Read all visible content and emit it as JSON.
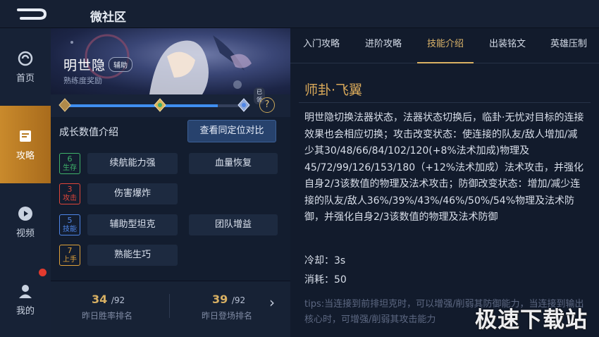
{
  "topbar": {
    "title": "微社区",
    "back_icon": "back-arrow-icon"
  },
  "sidebar": {
    "items": [
      {
        "label": "首页",
        "icon": "home-icon",
        "active": false
      },
      {
        "label": "攻略",
        "icon": "guide-icon",
        "active": true
      },
      {
        "label": "视频",
        "icon": "play-icon",
        "active": false
      },
      {
        "label": "我的",
        "icon": "user-icon",
        "active": false,
        "notification": true
      }
    ]
  },
  "hero": {
    "name": "明世隐",
    "role": "辅助",
    "proficiency_label": "熟练度奖励",
    "progress": 0.83,
    "completed_tag": "已领",
    "help": "?"
  },
  "growth": {
    "title": "成长数值介绍",
    "compare_button": "查看同定位对比",
    "stats": [
      {
        "value": "6",
        "label": "生存",
        "color": "#3fb26a"
      },
      {
        "value": "3",
        "label": "攻击",
        "color": "#e0463a"
      },
      {
        "value": "5",
        "label": "技能",
        "color": "#4f86e8"
      },
      {
        "value": "7",
        "label": "上手",
        "color": "#e0a23a"
      }
    ],
    "traits": [
      {
        "text": "续航能力强"
      },
      {
        "text": "血量恢复"
      },
      {
        "text": "伤害爆炸"
      },
      {
        "text": "辅助型坦克"
      },
      {
        "text": "团队增益"
      },
      {
        "text": "熟能生巧"
      }
    ]
  },
  "ranks": [
    {
      "value": "34",
      "total": "/92",
      "label": "昨日胜率排名"
    },
    {
      "value": "39",
      "total": "/92",
      "label": "昨日登场排名"
    }
  ],
  "tabs": [
    {
      "label": "入门攻略",
      "active": false
    },
    {
      "label": "进阶攻略",
      "active": false
    },
    {
      "label": "技能介绍",
      "active": true
    },
    {
      "label": "出装铭文",
      "active": false
    },
    {
      "label": "英雄压制",
      "active": false
    }
  ],
  "skill": {
    "name": "师卦·飞翼",
    "description": "明世隐切换法器状态，法器状态切换后，临卦·无忧对目标的连接效果也会相应切换；攻击改变状态：使连接的队友/敌人增加/减少其30/48/66/84/102/120(+8%法术加成)物理及45/72/99/126/153/180（+12%法术加成）法术攻击，并强化自身2/3该数值的物理及法术攻击；防御改变状态：增加/减少连接的队友/敌人36%/39%/43%/46%/50%/54%物理及法术防御，并强化自身2/3该数值的物理及法术防御",
    "cooldown": "冷却：3s",
    "cost": "消耗：50",
    "tips": "tips:当连接到前排坦克时，可以增强/削弱其防御能力，当连接到输出核心时，可增强/削弱其攻击能力"
  },
  "watermark": "极速下载站"
}
